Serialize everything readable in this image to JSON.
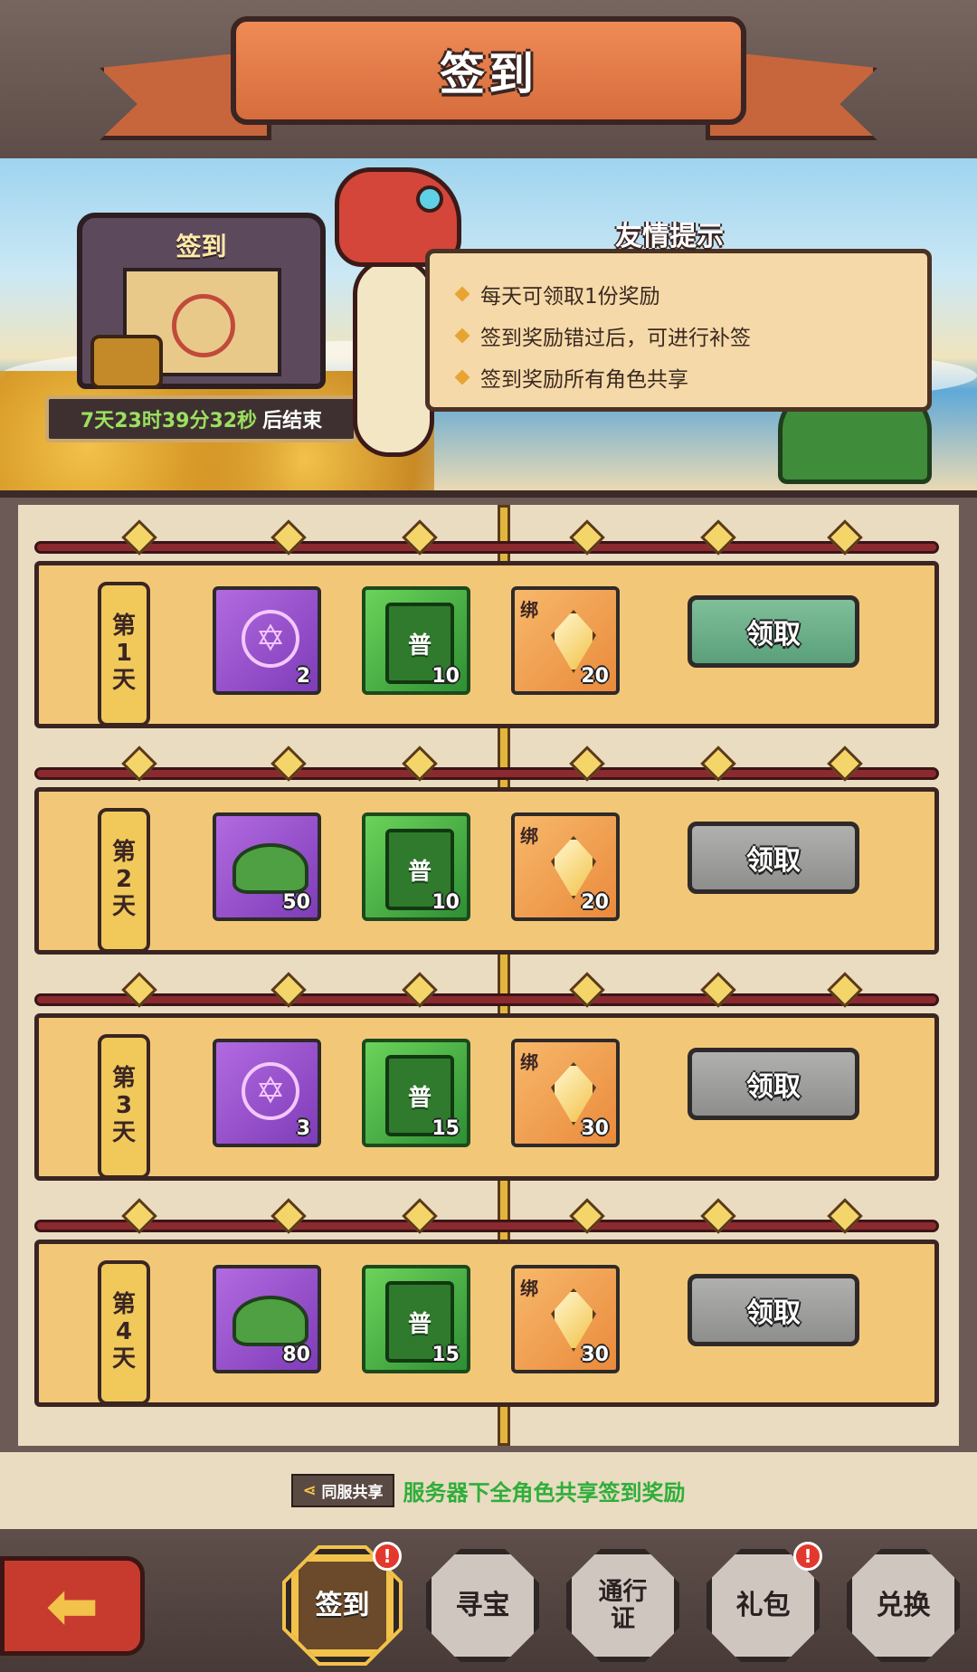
{
  "header": {
    "title": "签到"
  },
  "banner": {
    "sign_title": "签到",
    "timer": {
      "countdown": "7天23时39分32秒",
      "suffix": "后结束"
    },
    "tips": {
      "title": "友情提示",
      "items": [
        "每天可领取1份奖励",
        "签到奖励错过后，可进行补签",
        "签到奖励所有角色共享"
      ]
    }
  },
  "days": [
    {
      "day_chars": [
        "第",
        "1",
        "天"
      ],
      "button": "领取",
      "button_state": "active",
      "rewards": [
        {
          "icon": "hexagram-crystal-icon",
          "count": "2"
        },
        {
          "icon": "common-book-icon",
          "label": "普",
          "count": "10"
        },
        {
          "icon": "bound-crystal-icon",
          "label": "绑",
          "count": "20"
        }
      ]
    },
    {
      "day_chars": [
        "第",
        "2",
        "天"
      ],
      "button": "领取",
      "button_state": "inactive",
      "rewards": [
        {
          "icon": "zongzi-icon",
          "count": "50"
        },
        {
          "icon": "common-book-icon",
          "label": "普",
          "count": "10"
        },
        {
          "icon": "bound-crystal-icon",
          "label": "绑",
          "count": "20"
        }
      ]
    },
    {
      "day_chars": [
        "第",
        "3",
        "天"
      ],
      "button": "领取",
      "button_state": "inactive",
      "rewards": [
        {
          "icon": "hexagram-crystal-icon",
          "count": "3"
        },
        {
          "icon": "common-book-icon",
          "label": "普",
          "count": "15"
        },
        {
          "icon": "bound-crystal-icon",
          "label": "绑",
          "count": "30"
        }
      ]
    },
    {
      "day_chars": [
        "第",
        "4",
        "天"
      ],
      "button": "领取",
      "button_state": "inactive",
      "rewards": [
        {
          "icon": "zongzi-icon",
          "count": "80"
        },
        {
          "icon": "common-book-icon",
          "label": "普",
          "count": "15"
        },
        {
          "icon": "bound-crystal-icon",
          "label": "绑",
          "count": "30"
        }
      ]
    }
  ],
  "share": {
    "tag": "同服共享",
    "text": "服务器下全角色共享签到奖励"
  },
  "nav": [
    {
      "label": "签到",
      "selected": true,
      "badge": "!"
    },
    {
      "label": "寻宝",
      "selected": false
    },
    {
      "label": "通行证",
      "selected": false
    },
    {
      "label": "礼包",
      "selected": false,
      "badge": "!"
    },
    {
      "label": "兑换",
      "selected": false
    }
  ],
  "colors": {
    "accent_gold": "#f2c24a",
    "claim_active": "#6fb38c",
    "claim_inactive": "#9e9e9c",
    "timer_green": "#9be060",
    "share_green": "#2fae3a",
    "badge_red": "#e3382e"
  }
}
